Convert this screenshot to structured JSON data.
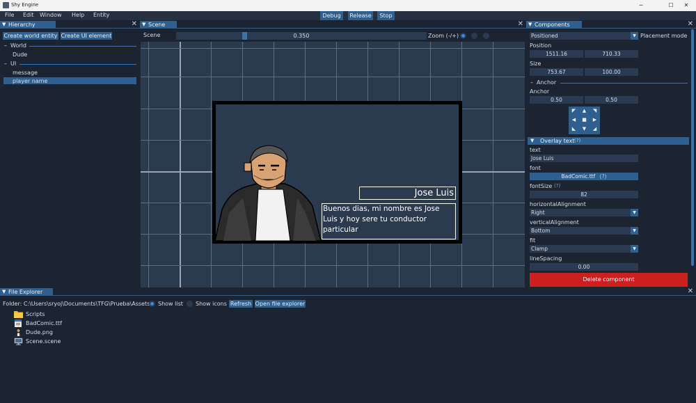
{
  "window": {
    "title": "Shy Engine",
    "minimize": "─",
    "maximize": "☐",
    "close": "✕"
  },
  "menu": {
    "items": [
      "File",
      "Edit",
      "Window",
      "Help",
      "Entity"
    ]
  },
  "toolbar": {
    "debug": "Debug",
    "release": "Release",
    "stop": "Stop"
  },
  "hierarchy": {
    "tab": "Hierarchy",
    "create_world_entity": "Create world entity",
    "create_ui_element": "Create UI element",
    "world_header": "World",
    "world_items": [
      "Dude"
    ],
    "ui_header": "UI",
    "ui_items": [
      "message",
      "player name"
    ],
    "selected": "player name"
  },
  "scene": {
    "tab": "Scene",
    "label": "Scene",
    "zoom_value": "0.350",
    "zoom_label": "Zoom (-/+)",
    "overlay_name": "Jose Luis",
    "overlay_message": "Buenos dias, mi nombre es Jose Luis y hoy sere tu conductor particular"
  },
  "components": {
    "tab": "Components",
    "mode_select": "Positioned",
    "placement_mode": "Placement mode",
    "position_label": "Position",
    "position_x": "1511.16",
    "position_y": "710.33",
    "size_label": "Size",
    "size_w": "753.67",
    "size_h": "100.00",
    "anchor_section": "Anchor",
    "anchor_label": "Anchor",
    "anchor_x": "0.50",
    "anchor_y": "0.50",
    "overlay_section": "Overlay text",
    "help": "(?)",
    "text_label": "text",
    "text_value": "Jose Luis",
    "font_label": "font",
    "font_value": "BadComic.ttf",
    "font_size_label": "fontSize",
    "font_size_value": "82",
    "h_align_label": "horizontalAlignment",
    "h_align_value": "Right",
    "v_align_label": "verticalAlignment",
    "v_align_value": "Bottom",
    "fit_label": "fit",
    "fit_value": "Clamp",
    "line_spacing_label": "lineSpacing",
    "line_spacing_value": "0.00",
    "delete_component": "Delete component"
  },
  "file_explorer": {
    "tab": "File Explorer",
    "folder_label": "Folder: C:\\Users\\sryoj\\Documents\\TFG\\Prueba\\Assets",
    "show_list": "Show list",
    "show_icons": "Show icons",
    "refresh": "Refresh",
    "open_explorer": "Open file explorer",
    "files": [
      {
        "name": "Scripts",
        "icon": "folder-icon"
      },
      {
        "name": "BadComic.ttf",
        "icon": "font-file-icon"
      },
      {
        "name": "Dude.png",
        "icon": "image-file-icon"
      },
      {
        "name": "Scene.scene",
        "icon": "scene-file-icon"
      }
    ]
  },
  "colors": {
    "accent": "#2f5f8f",
    "background": "#1c2431",
    "danger": "#cc1f1f",
    "scene_bg": "#2b3a4f"
  }
}
